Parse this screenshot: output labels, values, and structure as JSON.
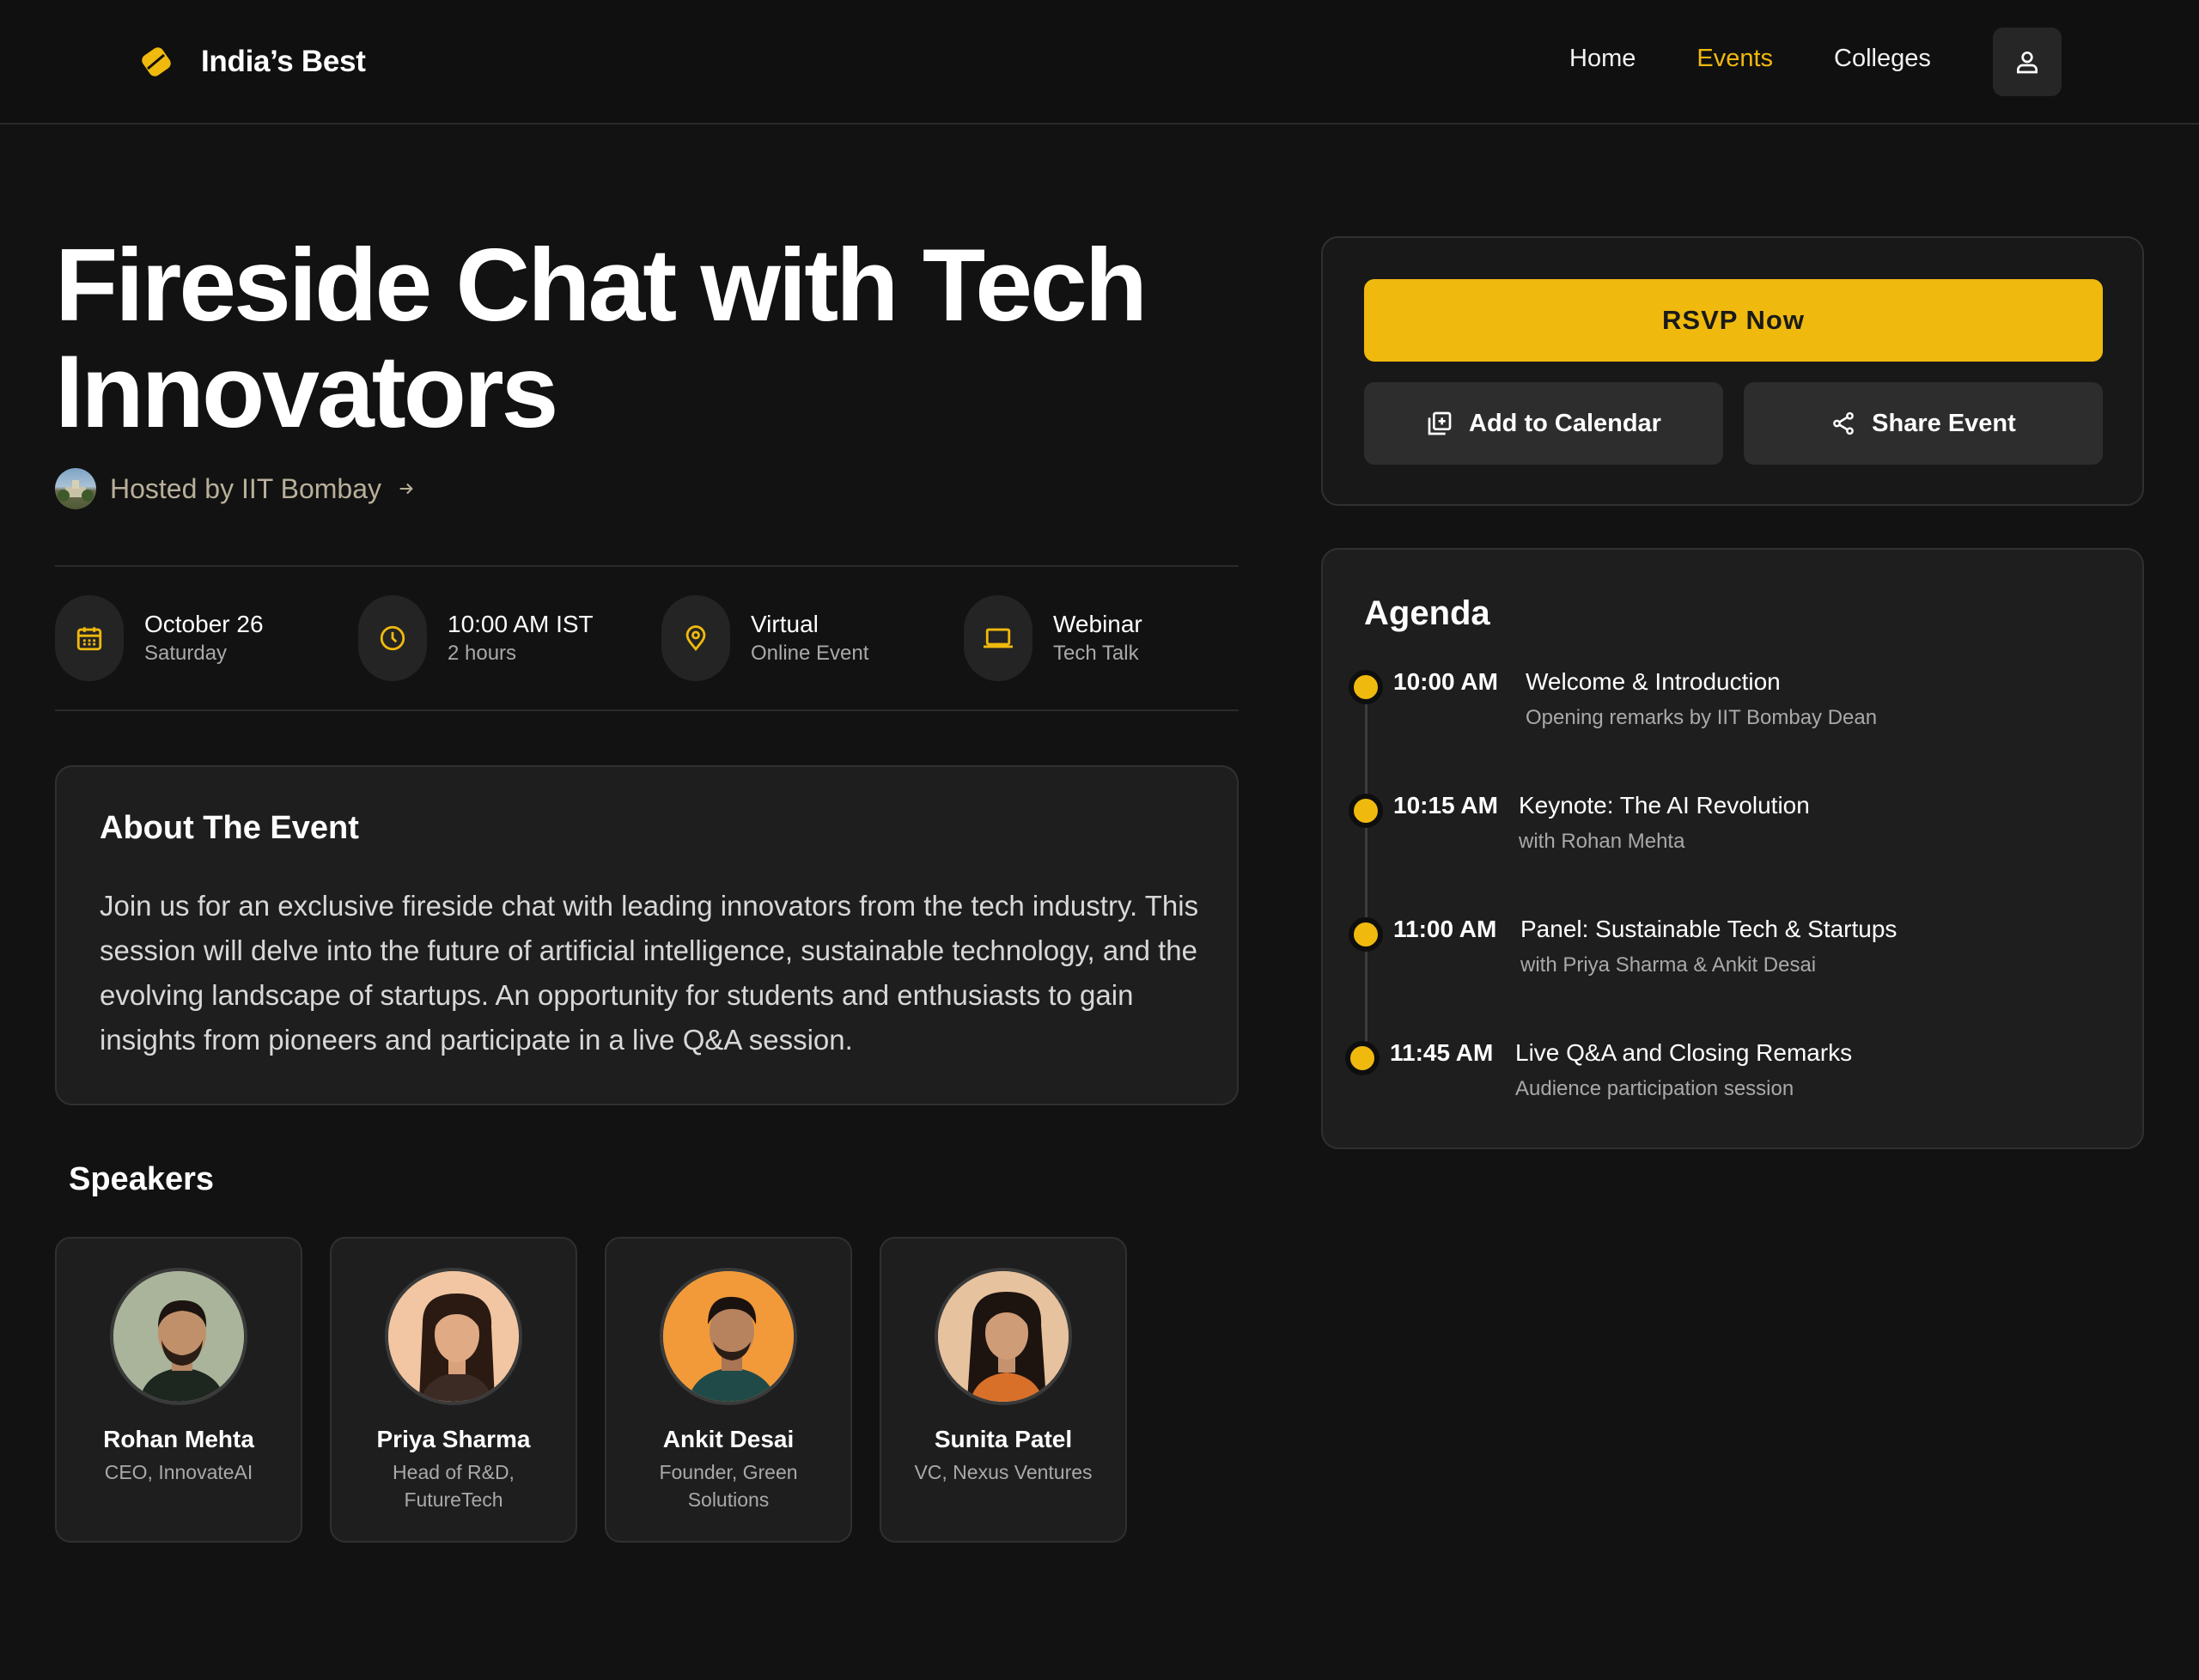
{
  "brand": {
    "name": "India’s Best",
    "logo_icon": "brand-gem-icon"
  },
  "nav": {
    "links": [
      "Home",
      "Events",
      "Colleges"
    ],
    "active": "Events",
    "profile_icon": "user-icon"
  },
  "colors": {
    "accent": "#f0b90e",
    "background": "#121212",
    "card": "#1e1e1e"
  },
  "event": {
    "title": "Fireside Chat with Tech Innovators",
    "host_label": "Hosted by IIT Bombay",
    "meta": [
      {
        "icon": "calendar-icon",
        "main": "October 26",
        "sub": "Saturday"
      },
      {
        "icon": "clock-icon",
        "main": "10:00 AM IST",
        "sub": "2 hours"
      },
      {
        "icon": "location-pin-icon",
        "main": "Virtual",
        "sub": "Online Event"
      },
      {
        "icon": "laptop-icon",
        "main": "Webinar",
        "sub": "Tech Talk"
      }
    ]
  },
  "about": {
    "title": "About The Event",
    "body": "Join us for an exclusive fireside chat with leading innovators from the tech industry. This session will delve into the future of artificial intelligence, sustainable technology, and the evolving landscape of startups. An opportunity for students and enthusiasts to gain insights from pioneers and participate in a live Q&A session."
  },
  "speakers": {
    "title": "Speakers",
    "items": [
      {
        "name": "Rohan Mehta",
        "role": "CEO, InnovateAI"
      },
      {
        "name": "Priya Sharma",
        "role": "Head of R&D, FutureTech"
      },
      {
        "name": "Ankit Desai",
        "role": "Founder, Green Solutions"
      },
      {
        "name": "Sunita Patel",
        "role": "VC, Nexus Ventures"
      }
    ]
  },
  "actions": {
    "rsvp": "RSVP Now",
    "calendar": "Add to Calendar",
    "share": "Share Event"
  },
  "agenda": {
    "title": "Agenda",
    "items": [
      {
        "time": "10:00 AM",
        "title": "Welcome & Introduction",
        "desc": "Opening remarks by IIT Bombay Dean"
      },
      {
        "time": "10:15 AM",
        "title": "Keynote: The AI Revolution",
        "desc": "with Rohan Mehta"
      },
      {
        "time": "11:00 AM",
        "title": "Panel: Sustainable Tech & Startups",
        "desc": "with Priya Sharma & Ankit Desai"
      },
      {
        "time": "11:45 AM",
        "title": "Live Q&A and Closing Remarks",
        "desc": "Audience participation session"
      }
    ]
  }
}
